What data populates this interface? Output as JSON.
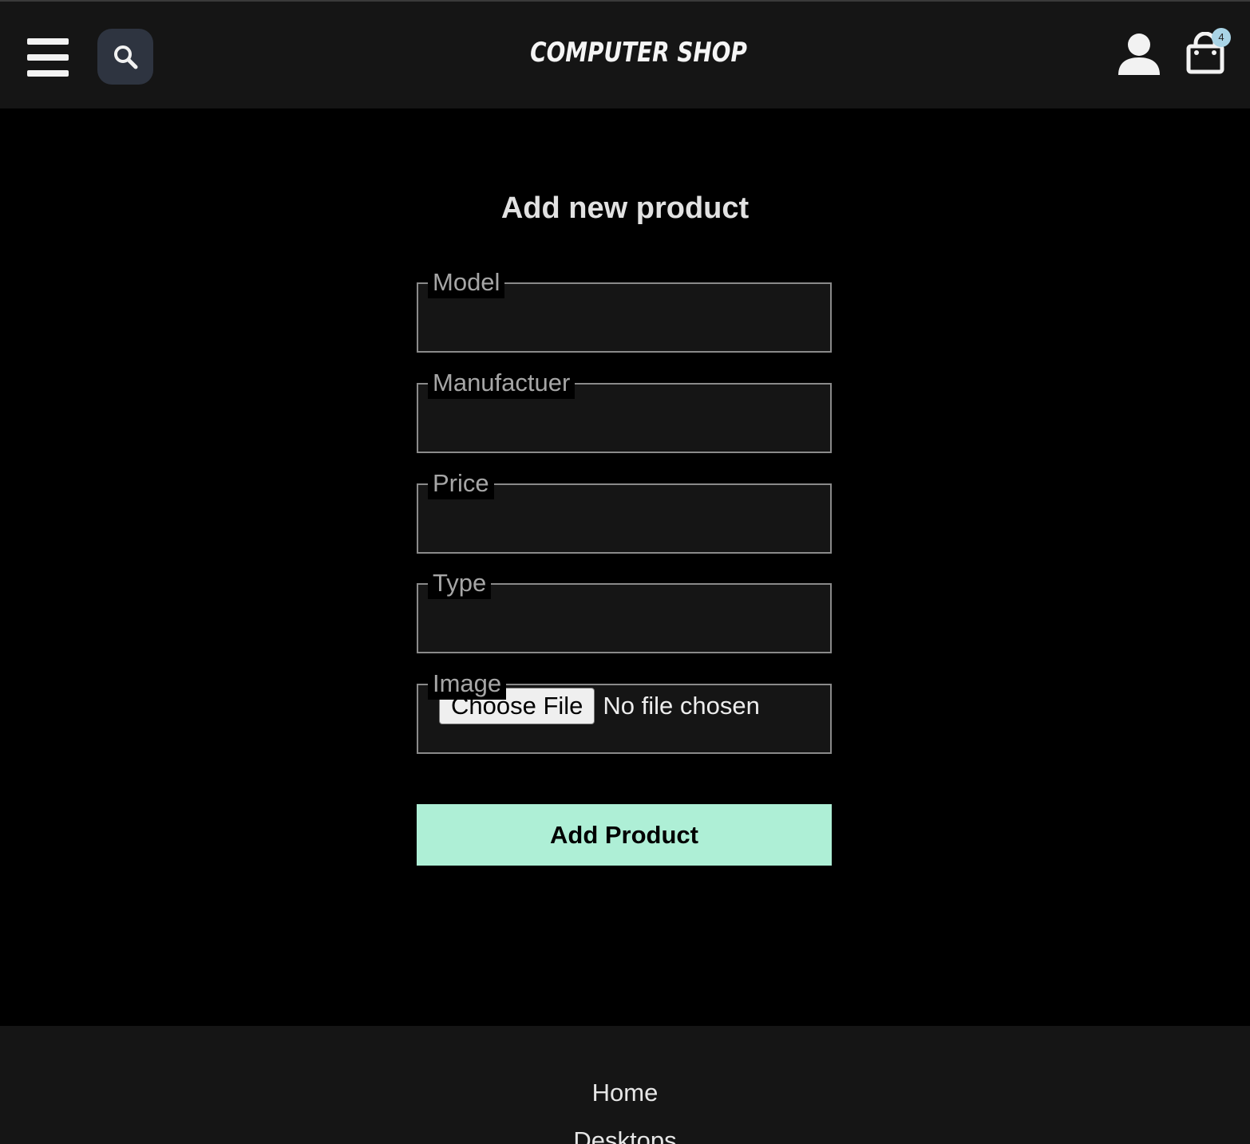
{
  "header": {
    "brand": "COMPUTER SHOP",
    "cart_count": "4",
    "icons": {
      "menu": "hamburger-menu-icon",
      "search": "search-icon",
      "user": "user-icon",
      "cart": "shopping-bag-icon"
    }
  },
  "form": {
    "title": "Add new product",
    "fields": [
      {
        "label": "Model",
        "value": ""
      },
      {
        "label": "Manufactuer",
        "value": ""
      },
      {
        "label": "Price",
        "value": ""
      },
      {
        "label": "Type",
        "value": ""
      }
    ],
    "image": {
      "label": "Image",
      "button_label": "Choose File",
      "status": "No file chosen"
    },
    "submit_label": "Add Product"
  },
  "footer": {
    "links": [
      "Home",
      "Desktops"
    ]
  },
  "colors": {
    "header_bg": "#151515",
    "page_bg": "#000000",
    "accent": "#aeefd6",
    "badge": "#a9d4e6"
  }
}
